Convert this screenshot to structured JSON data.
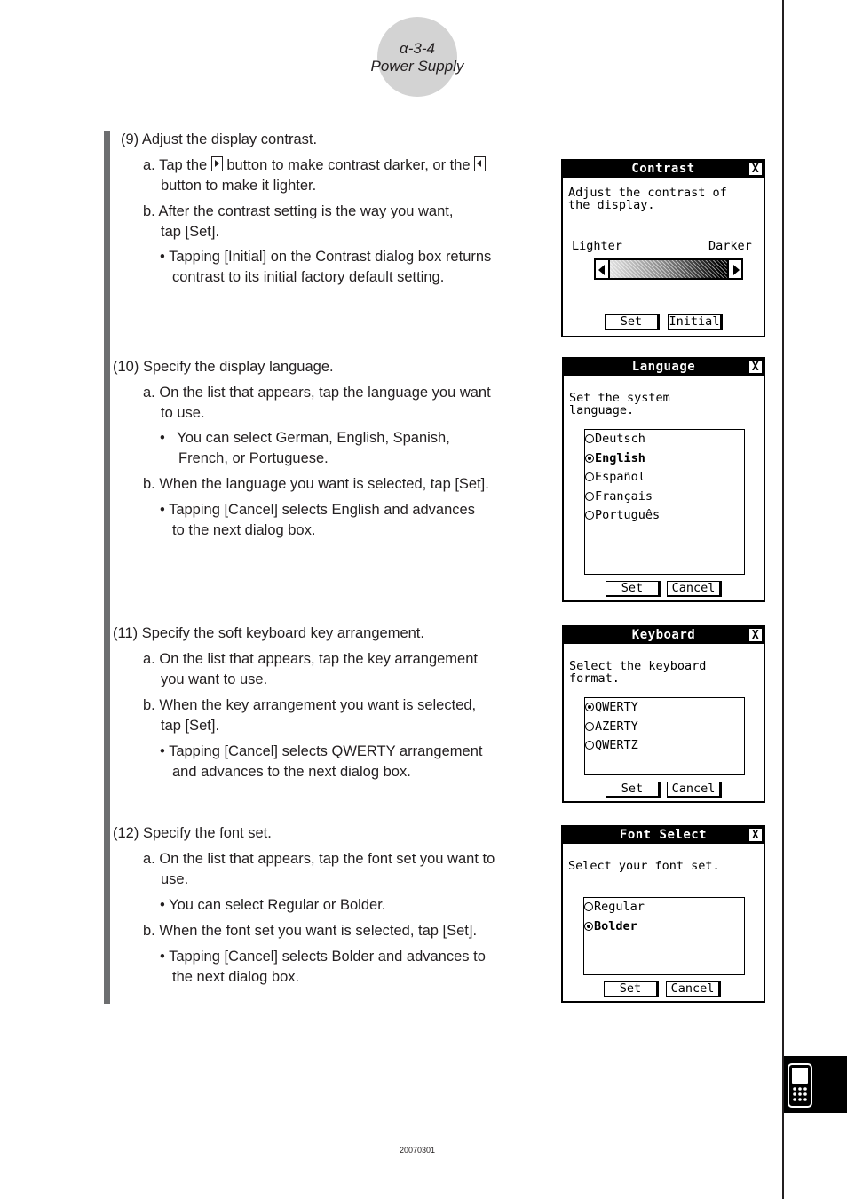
{
  "header": {
    "code": "α-3-4",
    "title": "Power Supply"
  },
  "steps": [
    {
      "number": "(9)",
      "title": "Adjust the display contrast.",
      "a_prefix": "a.",
      "a_part1": "Tap the",
      "a_part2": "button to make contrast darker, or the",
      "a_line2": "button to make it lighter.",
      "b_prefix": "b.",
      "b_line1": "After the contrast setting is the way you want,",
      "b_line2": "tap [Set].",
      "note_bullet": "•",
      "note_line1": "Tapping [Initial] on the Contrast dialog box returns",
      "note_line2": "contrast to its initial factory default setting."
    },
    {
      "number": "(10)",
      "title": "Specify the display language.",
      "a_prefix": "a.",
      "a_line1": "On the list that appears, tap the language you want",
      "a_line2": "to use.",
      "a_note_bullet": "•",
      "a_note_line1": "You can select German, English, Spanish,",
      "a_note_line2": "French, or Portuguese.",
      "b_prefix": "b.",
      "b_line1": "When the language you want is selected, tap [Set].",
      "note_bullet": "•",
      "note_line1": "Tapping [Cancel] selects English and advances",
      "note_line2": "to the next dialog box."
    },
    {
      "number": "(11)",
      "title": "Specify the soft keyboard key arrangement.",
      "a_prefix": "a.",
      "a_line1": "On the list that appears, tap the key arrangement",
      "a_line2": "you want to use.",
      "b_prefix": "b.",
      "b_line1": "When the key arrangement you want is selected,",
      "b_line2": "tap [Set].",
      "note_bullet": "•",
      "note_line1": "Tapping [Cancel] selects QWERTY arrangement",
      "note_line2": "and advances to the next dialog box."
    },
    {
      "number": "(12)",
      "title": "Specify the font set.",
      "a_prefix": "a.",
      "a_line1": "On the list that appears, tap the font set you want to",
      "a_line2": "use.",
      "a_note_bullet": "•",
      "a_note_line1": "You can select Regular or Bolder.",
      "b_prefix": "b.",
      "b_line1": "When the font set you want is selected, tap [Set].",
      "note_bullet": "•",
      "note_line1": "Tapping [Cancel] selects Bolder and advances to",
      "note_line2": "the next dialog box."
    }
  ],
  "dialogs": {
    "contrast": {
      "title": "Contrast",
      "close": "X",
      "message": "Adjust the contrast of\nthe display.",
      "label_left": "Lighter",
      "label_right": "Darker",
      "buttons": [
        "Set",
        "Initial"
      ]
    },
    "language": {
      "title": "Language",
      "close": "X",
      "message": "Set the system\nlanguage.",
      "options": [
        {
          "label": "Deutsch",
          "selected": false
        },
        {
          "label": "English",
          "selected": true
        },
        {
          "label": "Español",
          "selected": false
        },
        {
          "label": "Français",
          "selected": false
        },
        {
          "label": "Português",
          "selected": false
        }
      ],
      "buttons": [
        "Set",
        "Cancel"
      ]
    },
    "keyboard": {
      "title": "Keyboard",
      "close": "X",
      "message": "Select the keyboard\nformat.",
      "options": [
        {
          "label": "QWERTY",
          "selected": true
        },
        {
          "label": "AZERTY",
          "selected": false
        },
        {
          "label": "QWERTZ",
          "selected": false
        }
      ],
      "buttons": [
        "Set",
        "Cancel"
      ]
    },
    "font_select": {
      "title": "Font Select",
      "close": "X",
      "message": "Select your font set.",
      "options": [
        {
          "label": "Regular",
          "selected": false
        },
        {
          "label": "Bolder",
          "selected": true
        }
      ],
      "buttons": [
        "Set",
        "Cancel"
      ]
    }
  },
  "side_tab": {
    "icon": "calculator-icon"
  },
  "footer": {
    "code": "20070301"
  }
}
